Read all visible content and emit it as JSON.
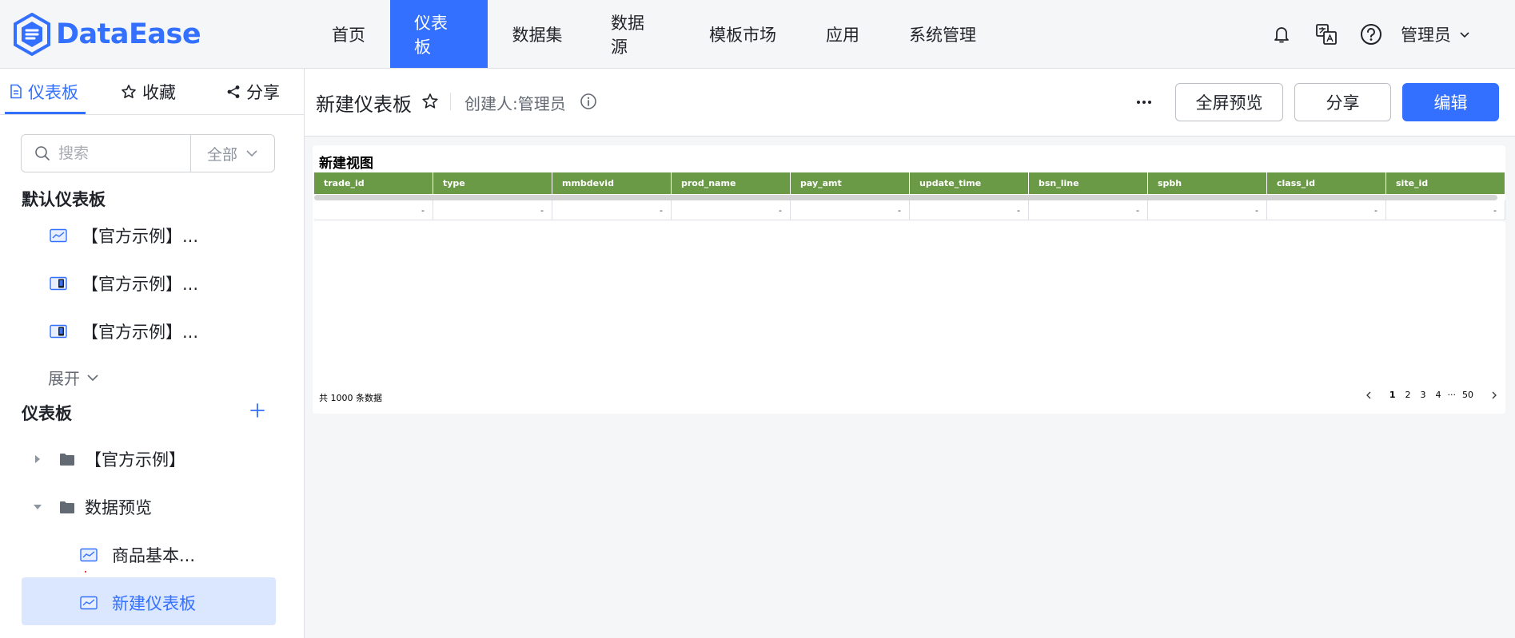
{
  "app": {
    "name": "DataEase",
    "accent": "#3370ff"
  },
  "nav": {
    "items": [
      "首页",
      "仪表板",
      "数据集",
      "数据源",
      "模板市场",
      "应用",
      "系统管理"
    ],
    "active": "仪表板"
  },
  "user": {
    "name": "管理员",
    "icons": [
      "bell-icon",
      "translate-icon",
      "help-icon"
    ]
  },
  "sidebar": {
    "tabs": [
      {
        "label": "仪表板",
        "icon": "document-icon",
        "active": true
      },
      {
        "label": "收藏",
        "icon": "star-icon",
        "active": false
      },
      {
        "label": "分享",
        "icon": "share-icon",
        "active": false
      }
    ],
    "search": {
      "placeholder": "搜索",
      "filter": "全部"
    },
    "default_section": "默认仪表板",
    "default_items": [
      "【官方示例】...",
      "【官方示例】...",
      "【官方示例】..."
    ],
    "expand_label": "展开",
    "dashboard_section": "仪表板",
    "folders": [
      {
        "label": "【官方示例】",
        "expanded": false
      },
      {
        "label": "数据预览",
        "expanded": true
      }
    ],
    "children": [
      "商品基本...",
      "新建仪表板"
    ],
    "selected": "新建仪表板"
  },
  "header": {
    "title": "新建仪表板",
    "creator": "创建人:管理员",
    "buttons": {
      "fullscreen": "全屏预览",
      "share": "分享",
      "edit": "编辑"
    }
  },
  "view": {
    "title": "新建视图",
    "header_color": "#6b9a47",
    "columns": [
      "trade_id",
      "type",
      "mmbdevid",
      "prod_name",
      "pay_amt",
      "update_time",
      "bsn_line",
      "spbh",
      "class_id",
      "site_id"
    ],
    "row": [
      "-",
      "-",
      "-",
      "-",
      "-",
      "-",
      "-",
      "-",
      "-",
      "-"
    ],
    "total": "共 1000 条数据",
    "pages": [
      "1",
      "2",
      "3",
      "4",
      "···",
      "50"
    ]
  }
}
